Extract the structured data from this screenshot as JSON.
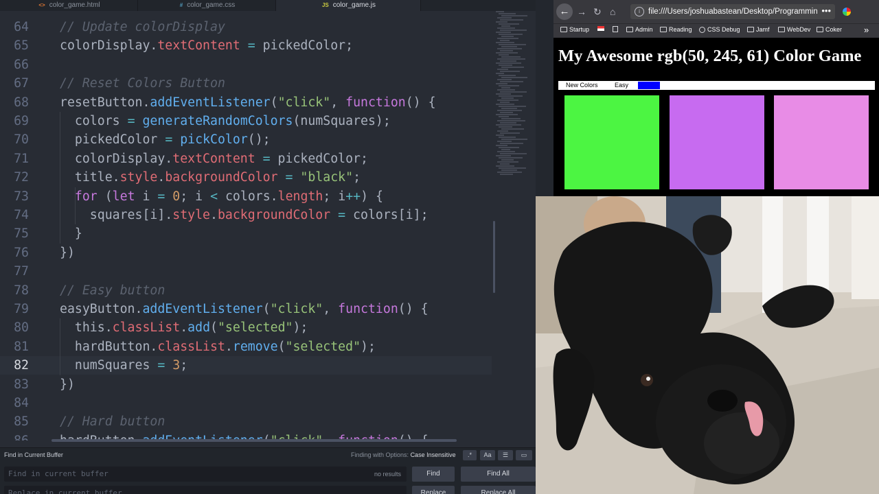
{
  "editor": {
    "tabs": [
      {
        "label": "color_game.html",
        "icon": "html-file-icon"
      },
      {
        "label": "color_game.css",
        "icon": "css-file-icon"
      },
      {
        "label": "color_game.js",
        "icon": "js-file-icon",
        "active": true
      }
    ],
    "lines": [
      {
        "n": "64",
        "tokens": [
          [
            "c-com",
            "// Update colorDisplay"
          ]
        ]
      },
      {
        "n": "65",
        "tokens": [
          [
            "c-var",
            "colorDisplay."
          ],
          [
            "c-prop",
            "textContent"
          ],
          [
            "c-var",
            " "
          ],
          [
            "c-op",
            "="
          ],
          [
            "c-var",
            " pickedColor;"
          ]
        ]
      },
      {
        "n": "66",
        "tokens": []
      },
      {
        "n": "67",
        "tokens": [
          [
            "c-com",
            "// Reset Colors Button"
          ]
        ]
      },
      {
        "n": "68",
        "tokens": [
          [
            "c-var",
            "resetButton."
          ],
          [
            "c-fn",
            "addEventListener"
          ],
          [
            "c-var",
            "("
          ],
          [
            "c-str",
            "\"click\""
          ],
          [
            "c-var",
            ", "
          ],
          [
            "c-kw",
            "function"
          ],
          [
            "c-var",
            "() {"
          ]
        ]
      },
      {
        "n": "69",
        "tokens": [
          [
            "c-var",
            "  colors "
          ],
          [
            "c-op",
            "="
          ],
          [
            "c-var",
            " "
          ],
          [
            "c-fn",
            "generateRandomColors"
          ],
          [
            "c-var",
            "(numSquares);"
          ]
        ]
      },
      {
        "n": "70",
        "tokens": [
          [
            "c-var",
            "  pickedColor "
          ],
          [
            "c-op",
            "="
          ],
          [
            "c-var",
            " "
          ],
          [
            "c-fn",
            "pickColor"
          ],
          [
            "c-var",
            "();"
          ]
        ]
      },
      {
        "n": "71",
        "tokens": [
          [
            "c-var",
            "  colorDisplay."
          ],
          [
            "c-prop",
            "textContent"
          ],
          [
            "c-var",
            " "
          ],
          [
            "c-op",
            "="
          ],
          [
            "c-var",
            " pickedColor;"
          ]
        ]
      },
      {
        "n": "72",
        "tokens": [
          [
            "c-var",
            "  title."
          ],
          [
            "c-prop",
            "style"
          ],
          [
            "c-var",
            "."
          ],
          [
            "c-prop",
            "backgroundColor"
          ],
          [
            "c-var",
            " "
          ],
          [
            "c-op",
            "="
          ],
          [
            "c-var",
            " "
          ],
          [
            "c-str",
            "\"black\""
          ],
          [
            "c-var",
            ";"
          ]
        ]
      },
      {
        "n": "73",
        "tokens": [
          [
            "c-var",
            "  "
          ],
          [
            "c-kw",
            "for"
          ],
          [
            "c-var",
            " ("
          ],
          [
            "c-kw",
            "let"
          ],
          [
            "c-var",
            " i "
          ],
          [
            "c-op",
            "="
          ],
          [
            "c-var",
            " "
          ],
          [
            "c-num",
            "0"
          ],
          [
            "c-var",
            "; i "
          ],
          [
            "c-op",
            "<"
          ],
          [
            "c-var",
            " colors."
          ],
          [
            "c-prop",
            "length"
          ],
          [
            "c-var",
            "; i"
          ],
          [
            "c-op",
            "++"
          ],
          [
            "c-var",
            ") {"
          ]
        ]
      },
      {
        "n": "74",
        "tokens": [
          [
            "c-var",
            "    squares[i]."
          ],
          [
            "c-prop",
            "style"
          ],
          [
            "c-var",
            "."
          ],
          [
            "c-prop",
            "backgroundColor"
          ],
          [
            "c-var",
            " "
          ],
          [
            "c-op",
            "="
          ],
          [
            "c-var",
            " colors[i];"
          ]
        ]
      },
      {
        "n": "75",
        "tokens": [
          [
            "c-var",
            "  }"
          ]
        ]
      },
      {
        "n": "76",
        "tokens": [
          [
            "c-var",
            "})"
          ]
        ]
      },
      {
        "n": "77",
        "tokens": []
      },
      {
        "n": "78",
        "tokens": [
          [
            "c-com",
            "// Easy button"
          ]
        ]
      },
      {
        "n": "79",
        "tokens": [
          [
            "c-var",
            "easyButton."
          ],
          [
            "c-fn",
            "addEventListener"
          ],
          [
            "c-var",
            "("
          ],
          [
            "c-str",
            "\"click\""
          ],
          [
            "c-var",
            ", "
          ],
          [
            "c-kw",
            "function"
          ],
          [
            "c-var",
            "() {"
          ]
        ]
      },
      {
        "n": "80",
        "tokens": [
          [
            "c-var",
            "  this."
          ],
          [
            "c-prop",
            "classList"
          ],
          [
            "c-var",
            "."
          ],
          [
            "c-fn",
            "add"
          ],
          [
            "c-var",
            "("
          ],
          [
            "c-str",
            "\"selected\""
          ],
          [
            "c-var",
            ");"
          ]
        ]
      },
      {
        "n": "81",
        "tokens": [
          [
            "c-var",
            "  hardButton."
          ],
          [
            "c-prop",
            "classList"
          ],
          [
            "c-var",
            "."
          ],
          [
            "c-fn",
            "remove"
          ],
          [
            "c-var",
            "("
          ],
          [
            "c-str",
            "\"selected\""
          ],
          [
            "c-var",
            ");"
          ]
        ]
      },
      {
        "n": "82",
        "current": true,
        "tokens": [
          [
            "c-var",
            "  numSquares "
          ],
          [
            "c-op",
            "="
          ],
          [
            "c-var",
            " "
          ],
          [
            "c-num",
            "3"
          ],
          [
            "c-var",
            ";"
          ]
        ]
      },
      {
        "n": "83",
        "tokens": [
          [
            "c-var",
            "})"
          ]
        ]
      },
      {
        "n": "84",
        "tokens": []
      },
      {
        "n": "85",
        "tokens": [
          [
            "c-com",
            "// Hard button"
          ]
        ]
      },
      {
        "n": "86",
        "tokens": [
          [
            "c-var",
            "hardButton."
          ],
          [
            "c-fn",
            "addEventListener"
          ],
          [
            "c-var",
            "("
          ],
          [
            "c-str",
            "\"click\""
          ],
          [
            "c-var",
            ", "
          ],
          [
            "c-kw",
            "function"
          ],
          [
            "c-var",
            "() {"
          ]
        ]
      }
    ],
    "find": {
      "title": "Find in Current Buffer",
      "options_label": "Finding with Options:",
      "options_value": "Case Insensitive",
      "regex_label": ".*",
      "case_label": "Aa",
      "find_placeholder": "Find in current buffer",
      "replace_placeholder": "Replace in current buffer",
      "result_count": "no results",
      "find_button": "Find",
      "find_all_button": "Find All",
      "replace_button": "Replace",
      "replace_all_button": "Replace All"
    }
  },
  "browser": {
    "url": "file:///Users/joshuabastean/Desktop/Programming",
    "more_label": "•••",
    "bookmarks": [
      "Startup",
      "Admin",
      "Reading",
      "CSS Debug",
      "Jamf",
      "WebDev",
      "Coker"
    ],
    "overflow_label": "»",
    "page": {
      "title": "My Awesome rgb(50, 245, 61) Color Game",
      "new_colors_label": "New Colors",
      "easy_label": "Easy",
      "squares": [
        "#4cf542",
        "#c76bf0",
        "#e88ce6"
      ]
    }
  }
}
